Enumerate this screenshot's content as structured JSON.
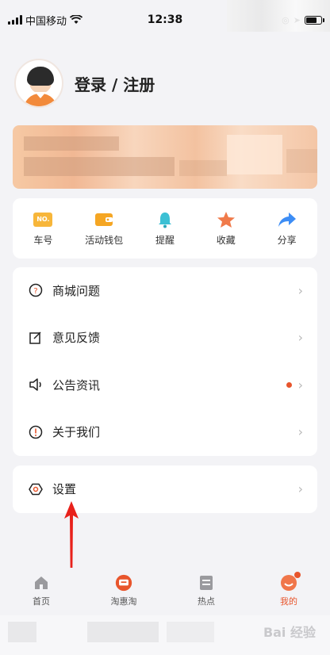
{
  "status_bar": {
    "carrier": "中国移动",
    "time": "12:38"
  },
  "profile": {
    "login_label": "登录 / 注册"
  },
  "shortcuts": [
    {
      "label": "车号",
      "icon": "car-number-icon",
      "badge_text": "NO."
    },
    {
      "label": "活动钱包",
      "icon": "wallet-icon"
    },
    {
      "label": "提醒",
      "icon": "bell-icon"
    },
    {
      "label": "收藏",
      "icon": "star-icon"
    },
    {
      "label": "分享",
      "icon": "share-icon"
    }
  ],
  "menu": [
    {
      "label": "商城问题",
      "icon": "question-icon"
    },
    {
      "label": "意见反馈",
      "icon": "feedback-icon"
    },
    {
      "label": "公告资讯",
      "icon": "speaker-icon",
      "has_dot": true
    },
    {
      "label": "关于我们",
      "icon": "info-icon"
    }
  ],
  "settings": {
    "label": "设置",
    "icon": "settings-icon"
  },
  "tabs": [
    {
      "label": "首页",
      "icon": "home-icon"
    },
    {
      "label": "淘惠淘",
      "icon": "taohuitao-icon"
    },
    {
      "label": "热点",
      "icon": "hot-news-icon"
    },
    {
      "label": "我的",
      "icon": "profile-icon",
      "active": true,
      "has_badge": true
    }
  ],
  "watermark": "Bai 经验",
  "colors": {
    "accent": "#e8552c",
    "page_bg": "#f3f3f6",
    "card_bg": "#ffffff"
  }
}
